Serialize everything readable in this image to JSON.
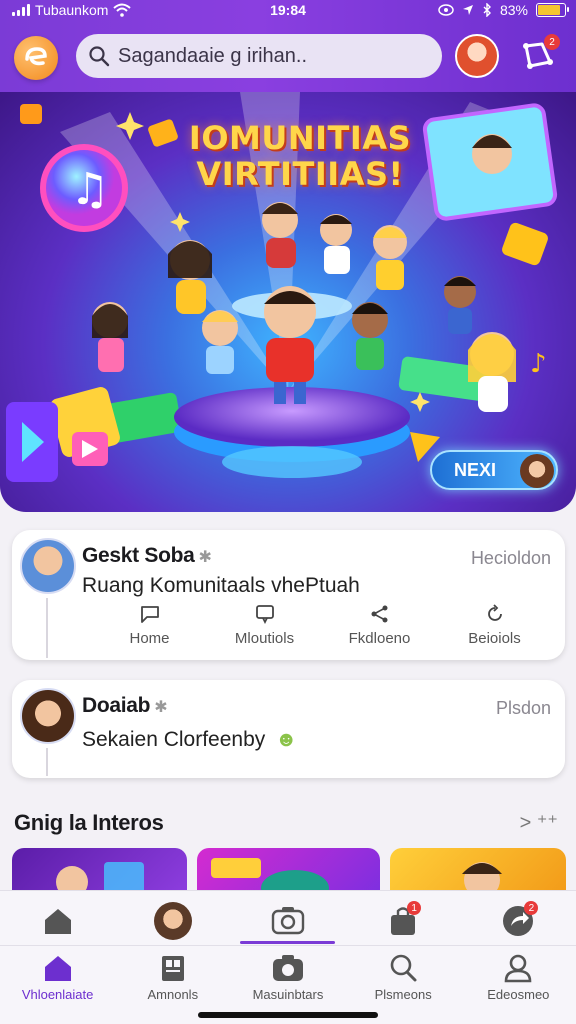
{
  "status": {
    "carrier": "Tubaunkom",
    "time": "19:84",
    "battery": "83%",
    "battery_level": 0.83
  },
  "search": {
    "placeholder": "Sagandaaie g irihan.."
  },
  "header": {
    "notification_count": "2"
  },
  "hero": {
    "title_line1": "IOMUNITIAS",
    "title_line2": "VIRTITIIAS!",
    "next_label": "NEXI"
  },
  "posts": [
    {
      "name": "Geskt Soba",
      "meta": "Hecioldon",
      "text": "Ruang Komunitaals vhePtuah",
      "actions": [
        {
          "label": "Home",
          "icon": "comment-icon"
        },
        {
          "label": "Mloutiols",
          "icon": "message-icon"
        },
        {
          "label": "Fkdloeno",
          "icon": "share-icon"
        },
        {
          "label": "Beioiols",
          "icon": "refresh-icon"
        }
      ]
    },
    {
      "name": "Doaiab",
      "meta": "Plsdon",
      "text": "Sekaien Clorfeenby",
      "emoji": "☻"
    }
  ],
  "section": {
    "title": "Gnig la Interos",
    "more": "> ⁺⁺"
  },
  "nav_top": [
    {
      "icon": "home-icon"
    },
    {
      "icon": "avatar-icon"
    },
    {
      "icon": "camera-icon",
      "active": true
    },
    {
      "icon": "bag-icon",
      "badge": "1"
    },
    {
      "icon": "share-icon",
      "badge": "2"
    }
  ],
  "nav_bottom": [
    {
      "label": "Vhloenlaiate",
      "icon": "home-icon",
      "active": true
    },
    {
      "label": "Amnonls",
      "icon": "doc-icon"
    },
    {
      "label": "Masuinbtars",
      "icon": "camera-icon"
    },
    {
      "label": "Plsmeons",
      "icon": "search-icon"
    },
    {
      "label": "Edeosmeo",
      "icon": "profile-icon"
    }
  ],
  "colors": {
    "brand": "#7b3bd6",
    "accent": "#f28a1c",
    "hero_title": "#ffd64a"
  }
}
